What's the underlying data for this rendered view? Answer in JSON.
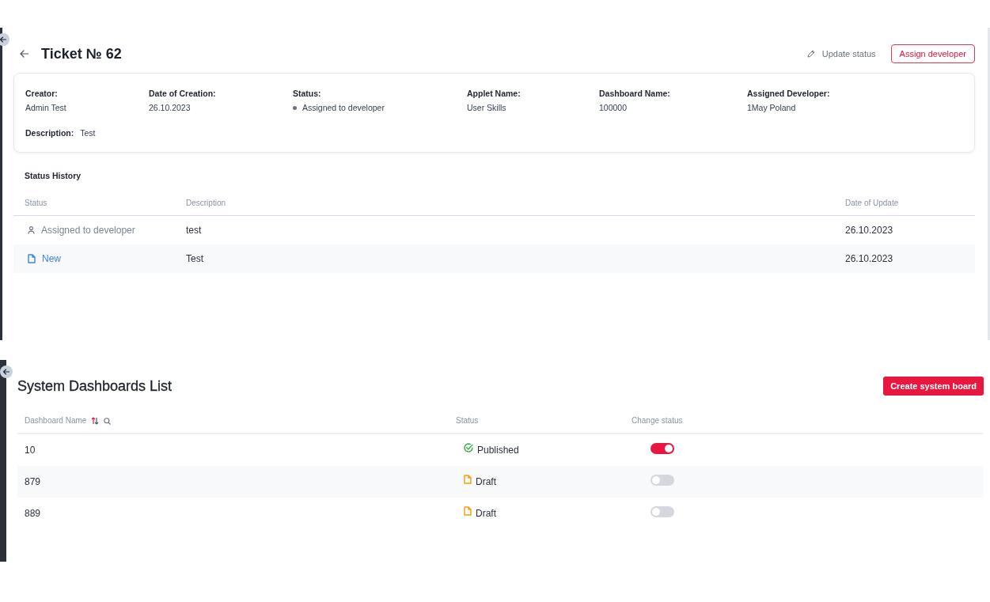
{
  "ticket": {
    "title": "Ticket № 62",
    "actions": [
      {
        "kind": "link",
        "label": "Update status"
      },
      {
        "kind": "outline",
        "label": "Assign developer"
      }
    ],
    "details": [
      {
        "kind": "text",
        "label": "Creator:",
        "value": "Admin Test"
      },
      {
        "kind": "text",
        "label": "Date of Creation:",
        "value": "26.10.2023"
      },
      {
        "kind": "status",
        "label": "Status:",
        "value": "Assigned to developer"
      },
      {
        "kind": "text",
        "label": "Applet Name:",
        "value": "User Skills"
      },
      {
        "kind": "text",
        "label": "Dashboard Name:",
        "value": "100000"
      },
      {
        "kind": "text",
        "label": "Assigned Developer:",
        "value": "1May Poland"
      }
    ],
    "description": {
      "label": "Description:",
      "value": "Test"
    },
    "status_history": {
      "title": "Status History",
      "columns": [
        "Status",
        "Description",
        "Date of Update"
      ],
      "rows": [
        {
          "kind": "assigned",
          "status": "Assigned to developer",
          "description": "test",
          "date": "26.10.2023"
        },
        {
          "kind": "new",
          "status": "New",
          "description": "Test",
          "date": "26.10.2023"
        }
      ]
    }
  },
  "dashboards": {
    "title": "System Dashboards List",
    "create_button": "Create system board",
    "columns": [
      {
        "kind": "filterable",
        "label": "Dashboard Name"
      },
      {
        "kind": "plain",
        "label": "Status"
      },
      {
        "kind": "plain",
        "label": "Change status"
      }
    ],
    "rows": [
      {
        "name": "10",
        "kind": "published",
        "status": "Published",
        "on": true
      },
      {
        "name": "879",
        "kind": "draft",
        "status": "Draft",
        "on": false
      },
      {
        "name": "889",
        "kind": "draft",
        "status": "Draft",
        "on": false
      }
    ]
  }
}
